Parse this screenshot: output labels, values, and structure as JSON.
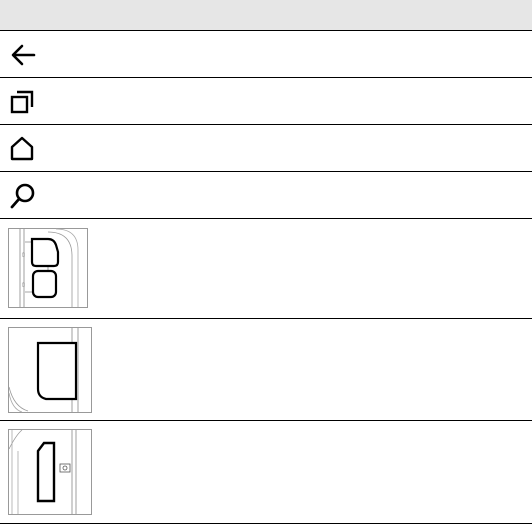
{
  "table": {
    "rows": [
      {
        "icon": "back-arrow-icon"
      },
      {
        "icon": "recent-apps-icon"
      },
      {
        "icon": "home-icon"
      },
      {
        "icon": "search-icon"
      },
      {
        "icon": "device-volume-buttons-diagram"
      },
      {
        "icon": "device-side-slot-diagram"
      },
      {
        "icon": "device-side-port-diagram"
      }
    ]
  }
}
